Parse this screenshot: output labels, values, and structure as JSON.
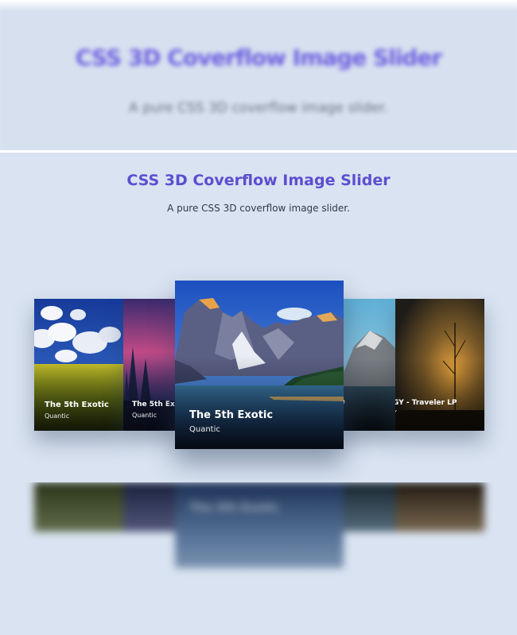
{
  "header_blurred": {
    "title": "CSS 3D Coverflow Image Slider",
    "subtitle": "A pure CSS 3D coverflow image slider."
  },
  "header": {
    "title": "CSS 3D Coverflow Image Slider",
    "subtitle": "A pure CSS 3D coverflow image slider."
  },
  "slides": [
    {
      "title": "The 5th Exotic",
      "subtitle": "Quantic"
    },
    {
      "title": "The 5th Exotic",
      "subtitle": "Quantic"
    },
    {
      "title": "The 5th Exotic",
      "subtitle": "Quantic"
    },
    {
      "title": "e",
      "subtitle": ""
    },
    {
      "title": "GY - Traveler LP",
      "subtitle": "Y"
    }
  ],
  "colors": {
    "background": "#d9e3f1",
    "title_accent": "#5b4fd0"
  }
}
